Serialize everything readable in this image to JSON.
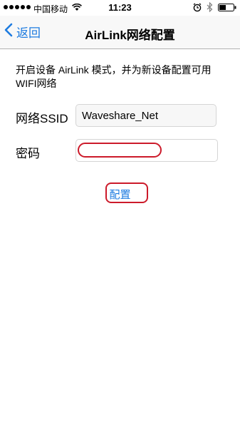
{
  "status_bar": {
    "carrier": "中国移动",
    "time": "11:23",
    "icons": [
      "signal-dots-icon",
      "wifi-icon",
      "alarm-icon",
      "bluetooth-icon",
      "battery-icon"
    ]
  },
  "nav": {
    "back_label": "返回",
    "title": "AirLink网络配置",
    "accent_color": "#1d7be0"
  },
  "form": {
    "description": "开启设备 AirLink 模式，并为新设备配置可用WIFI网络",
    "ssid_label": "网络SSID",
    "ssid_value": "Waveshare_Net",
    "password_label": "密码",
    "password_value": "",
    "submit_label": "配置"
  },
  "annotation_color": "#cc1a2a"
}
